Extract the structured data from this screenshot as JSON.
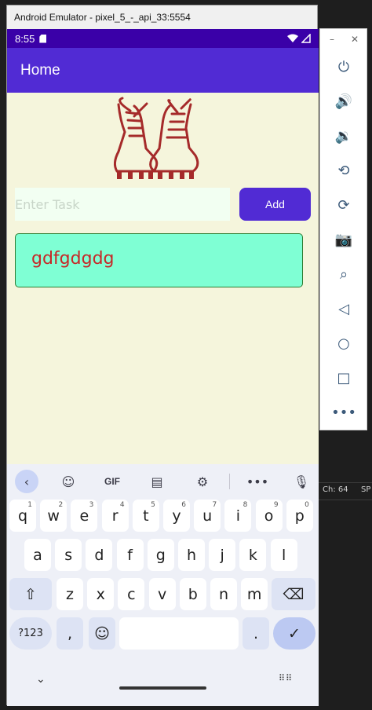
{
  "window": {
    "title": "Android Emulator - pixel_5_-_api_33:5554"
  },
  "status_bar": {
    "time": "8:55"
  },
  "app_bar": {
    "title": "Home"
  },
  "task_entry": {
    "placeholder": "Enter Task",
    "value": "",
    "add_label": "Add"
  },
  "tasks": [
    {
      "text": "gdfgdgdg"
    }
  ],
  "keyboard": {
    "toolbar": {
      "gif_label": "GIF"
    },
    "row1": [
      {
        "k": "q",
        "h": "1"
      },
      {
        "k": "w",
        "h": "2"
      },
      {
        "k": "e",
        "h": "3"
      },
      {
        "k": "r",
        "h": "4"
      },
      {
        "k": "t",
        "h": "5"
      },
      {
        "k": "y",
        "h": "6"
      },
      {
        "k": "u",
        "h": "7"
      },
      {
        "k": "i",
        "h": "8"
      },
      {
        "k": "o",
        "h": "9"
      },
      {
        "k": "p",
        "h": "0"
      }
    ],
    "row2": [
      "a",
      "s",
      "d",
      "f",
      "g",
      "h",
      "j",
      "k",
      "l"
    ],
    "row3": [
      "z",
      "x",
      "c",
      "v",
      "b",
      "n",
      "m"
    ],
    "sym_label": "?123",
    "comma": ",",
    "period": "."
  },
  "ide": {
    "col_label": "Ch: 64",
    "sp_label": "SP"
  },
  "colors": {
    "appbar": "#512bd4",
    "statusbar": "#3a00a8",
    "page_bg": "#f5f5dc",
    "task_card": "#7fffd4",
    "task_text": "#c62828"
  }
}
